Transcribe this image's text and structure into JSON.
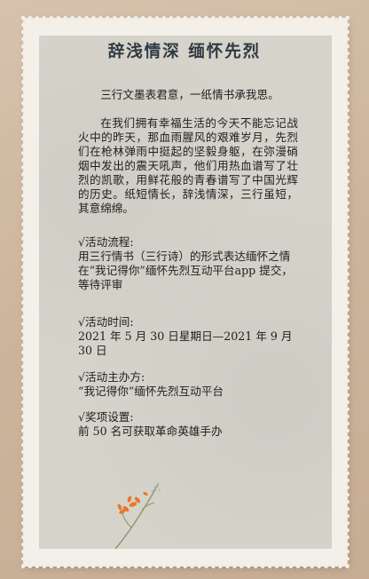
{
  "title": "辞浅情深 缅怀先烈",
  "intro": "三行文墨表君意，一纸情书承我思。",
  "body": "在我们拥有幸福生活的今天不能忘记战火中的昨天，那血雨腥风的艰难岁月，先烈们在枪林弹雨中挺起的坚毅身躯，在弥漫硝烟中发出的震天吼声，他们用热血谱写了壮烈的凯歌，用鲜花般的青春谱写了中国光辉的历史。纸短情长，辞浅情深，三行虽短，其意绵绵。",
  "sections": [
    {
      "heading": "√活动流程:",
      "lines": [
        "用三行情书（三行诗）的形式表达缅怀之情",
        "在“我记得你”缅怀先烈互动平台app 提交，等待评审"
      ]
    },
    {
      "heading": "√活动时间:",
      "lines": [
        "2021 年 5 月 30 日星期日—2021 年 9 月 30 日"
      ]
    },
    {
      "heading": "√活动主办方:",
      "lines": [
        "“我记得你”缅怀先烈互动平台"
      ]
    },
    {
      "heading": "√奖项设置:",
      "lines": [
        "前 50 名可获取革命英雄手办"
      ]
    }
  ],
  "decoration": {
    "flower_color": "#e8782a",
    "stem_color": "#8a9a6a"
  }
}
